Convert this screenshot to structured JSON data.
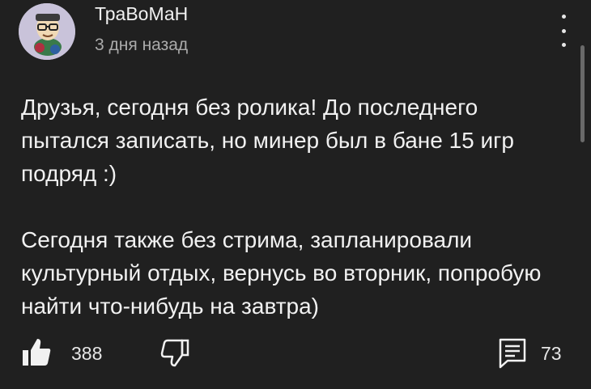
{
  "post": {
    "author": "ТраВоМаН",
    "time_ago": "3 дня назад",
    "paragraphs": [
      "Друзья, сегодня без ролика! До последнего пытался записать, но минер был в бане 15 игр подряд :)",
      "Сегодня также без стрима, запланировали культурный отдых, вернусь во вторник, попробую найти что-нибудь на завтра)"
    ]
  },
  "actions": {
    "likes": "388",
    "comments": "73"
  },
  "icons": {
    "like": "thumbs-up-icon",
    "dislike": "thumbs-down-icon",
    "comment": "comment-icon",
    "menu": "more-vert-icon"
  },
  "colors": {
    "background": "#202020",
    "text": "#f1f1f1",
    "secondary_text": "#aaaaaa"
  }
}
